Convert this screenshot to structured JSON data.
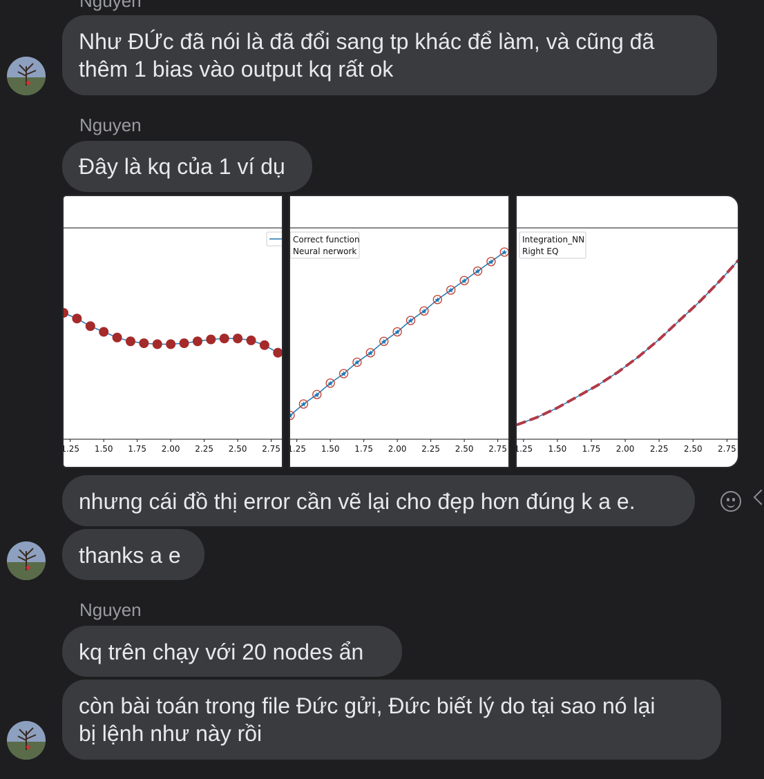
{
  "messages": {
    "sender_top": "Nguyen",
    "msg1": [
      "Như ĐỨc đã nói là đã đổi sang tp khác để làm, và cũng đã",
      "thêm 1 bias vào output kq rất ok"
    ],
    "sender2": "Nguyen",
    "msg2": "Đây là kq của 1 ví dụ",
    "msg3": "nhưng cái đồ thị error cần vẽ lại cho đẹp hơn đúng k a e.",
    "msg4": "thanks a e",
    "sender3": "Nguyen",
    "msg5": "kq trên chạy với 20 nodes ẩn",
    "msg6": [
      "còn bài toán trong file Đức gửi, Đức biết lý do tại sao nó lại",
      "bị lệnh như này rồi"
    ]
  },
  "icons": {
    "emoji": "smiley-face-icon",
    "more": "chevron-left-icon",
    "avatar": "avatar-photo"
  },
  "colors": {
    "background": "#1e1e20",
    "bubble": "#3a3b3e",
    "line_blue": "#1f77b4",
    "marker_red": "#a52a2a",
    "dashed_red": "#b03a48"
  },
  "chart_data": [
    {
      "type": "scatter",
      "x_ticks": [
        "1.25",
        "1.50",
        "1.75",
        "2.00",
        "2.25",
        "2.50",
        "2.75"
      ],
      "x": [
        1.2,
        1.3,
        1.4,
        1.5,
        1.6,
        1.7,
        1.8,
        1.9,
        2.0,
        2.1,
        2.2,
        2.3,
        2.4,
        2.5,
        2.6,
        2.7,
        2.8
      ],
      "series": [
        {
          "values": [
            0.64,
            0.61,
            0.57,
            0.54,
            0.51,
            0.49,
            0.48,
            0.475,
            0.475,
            0.48,
            0.49,
            0.5,
            0.505,
            0.505,
            0.495,
            0.47,
            0.43
          ]
        }
      ],
      "xlim": [
        1.2,
        2.85
      ],
      "ylim": [
        0,
        1
      ]
    },
    {
      "type": "line",
      "x_ticks": [
        "1.25",
        "1.50",
        "1.75",
        "2.00",
        "2.25",
        "2.50",
        "2.75"
      ],
      "legend": [
        "Correct function",
        "Neural nerwork"
      ],
      "x": [
        1.2,
        1.3,
        1.4,
        1.5,
        1.6,
        1.7,
        1.8,
        1.9,
        2.0,
        2.1,
        2.2,
        2.3,
        2.4,
        2.5,
        2.6,
        2.7,
        2.8
      ],
      "series": [
        {
          "name": "Correct function",
          "values": [
            0.1,
            0.16,
            0.21,
            0.27,
            0.32,
            0.38,
            0.43,
            0.49,
            0.54,
            0.6,
            0.65,
            0.71,
            0.76,
            0.81,
            0.86,
            0.91,
            0.96
          ]
        },
        {
          "name": "Neural nerwork",
          "values": [
            0.1,
            0.16,
            0.21,
            0.27,
            0.32,
            0.38,
            0.43,
            0.49,
            0.54,
            0.6,
            0.65,
            0.71,
            0.76,
            0.81,
            0.86,
            0.91,
            0.96
          ]
        }
      ],
      "xlim": [
        1.2,
        2.85
      ],
      "ylim": [
        0,
        1
      ]
    },
    {
      "type": "line",
      "x_ticks": [
        "1.25",
        "1.50",
        "1.75",
        "2.00",
        "2.25",
        "2.50",
        "2.75"
      ],
      "legend": [
        "Integration_NN",
        "Right EQ"
      ],
      "x": [
        1.2,
        1.35,
        1.5,
        1.65,
        1.8,
        1.95,
        2.1,
        2.25,
        2.4,
        2.55,
        2.7,
        2.85
      ],
      "series": [
        {
          "name": "Integration_NN",
          "values": [
            0.05,
            0.09,
            0.14,
            0.2,
            0.26,
            0.33,
            0.41,
            0.5,
            0.6,
            0.7,
            0.81,
            0.93
          ]
        },
        {
          "name": "Right EQ",
          "values": [
            0.05,
            0.09,
            0.14,
            0.2,
            0.26,
            0.33,
            0.41,
            0.5,
            0.6,
            0.7,
            0.81,
            0.93
          ]
        }
      ],
      "xlim": [
        1.2,
        2.85
      ],
      "ylim": [
        0,
        1
      ]
    }
  ]
}
